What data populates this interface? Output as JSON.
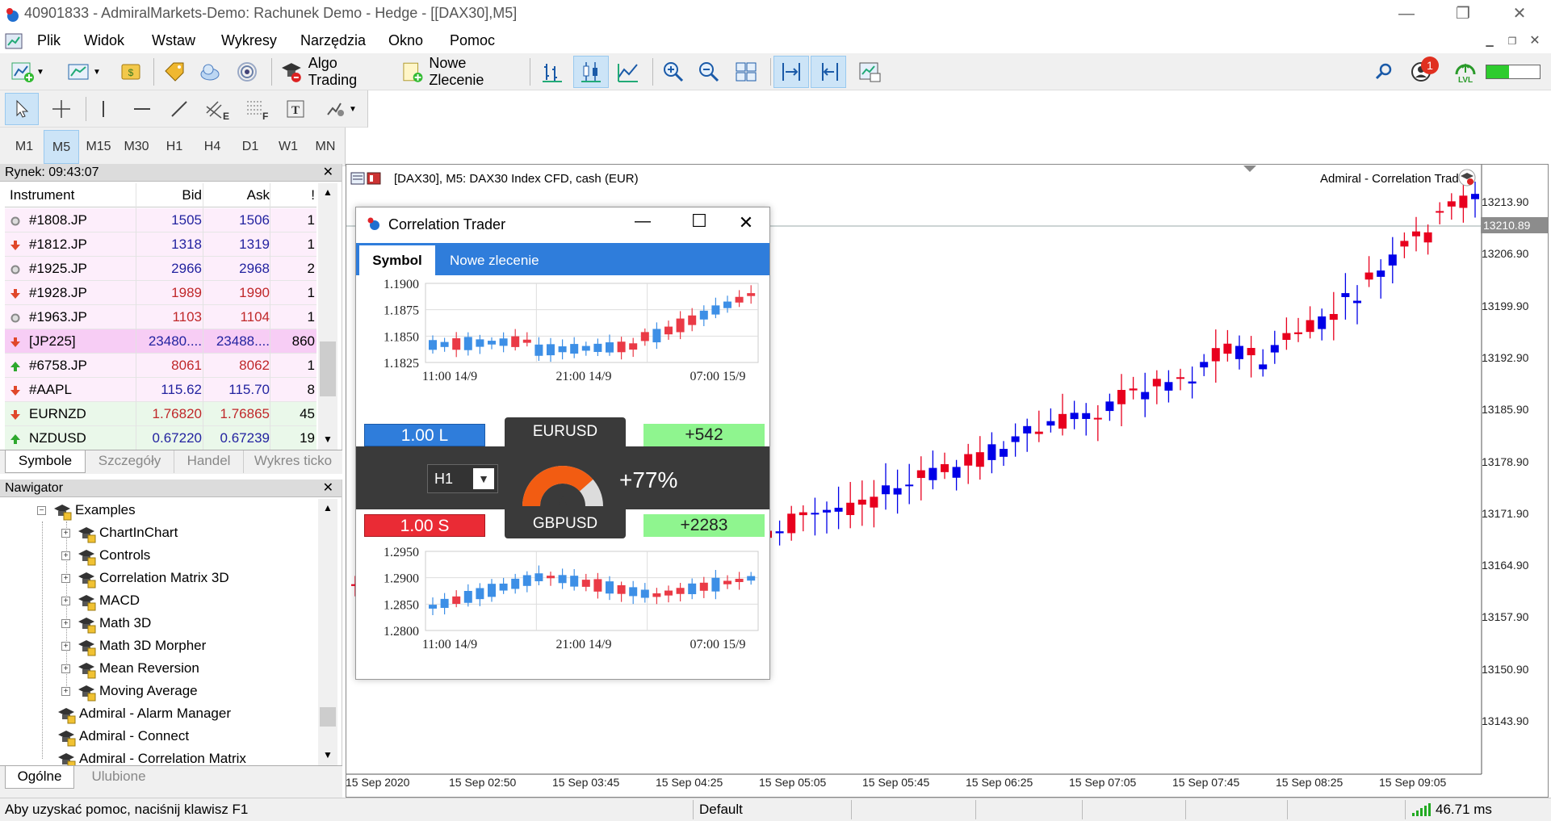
{
  "window": {
    "title": "40901833 - AdmiralMarkets-Demo: Rachunek Demo - Hedge - [[DAX30],M5]",
    "minimize": "—",
    "restore": "❐",
    "close": "✕"
  },
  "menu": [
    "Plik",
    "Widok",
    "Wstaw",
    "Wykresy",
    "Narzędzia",
    "Okno",
    "Pomoc"
  ],
  "toolbar": {
    "algo_trading": "Algo Trading",
    "new_order": "Nowe Zlecenie",
    "notification_count": "1",
    "lvl": "LVL"
  },
  "timeframes": [
    "M1",
    "M5",
    "M15",
    "M30",
    "H1",
    "H4",
    "D1",
    "W1",
    "MN"
  ],
  "active_timeframe": "M5",
  "market_watch": {
    "title": "Rynek: 09:43:07",
    "headers": {
      "instrument": "Instrument",
      "bid": "Bid",
      "ask": "Ask",
      "spread": "!"
    },
    "rows": [
      {
        "symbol": "#1808.JP",
        "bid": "1505",
        "ask": "1506",
        "spread": "1",
        "dir": "none",
        "color": "#2323a0",
        "bg": "#fdeefb"
      },
      {
        "symbol": "#1812.JP",
        "bid": "1318",
        "ask": "1319",
        "spread": "1",
        "dir": "down",
        "color": "#2323a0",
        "bg": "#fdeefb"
      },
      {
        "symbol": "#1925.JP",
        "bid": "2966",
        "ask": "2968",
        "spread": "2",
        "dir": "none",
        "color": "#2323a0",
        "bg": "#fdeefb"
      },
      {
        "symbol": "#1928.JP",
        "bid": "1989",
        "ask": "1990",
        "spread": "1",
        "dir": "down",
        "color": "#c0282a",
        "bg": "#fdeefb"
      },
      {
        "symbol": "#1963.JP",
        "bid": "1103",
        "ask": "1104",
        "spread": "1",
        "dir": "none",
        "color": "#c0282a",
        "bg": "#fdeefb"
      },
      {
        "symbol": "[JP225]",
        "bid": "23480....",
        "ask": "23488....",
        "spread": "860",
        "dir": "down",
        "color": "#2323a0",
        "bg": "#f7cdf5"
      },
      {
        "symbol": "#6758.JP",
        "bid": "8061",
        "ask": "8062",
        "spread": "1",
        "dir": "up",
        "color": "#c0282a",
        "bg": "#fdeefb"
      },
      {
        "symbol": "#AAPL",
        "bid": "115.62",
        "ask": "115.70",
        "spread": "8",
        "dir": "down",
        "color": "#2323a0",
        "bg": "#fdeefb"
      },
      {
        "symbol": "EURNZD",
        "bid": "1.76820",
        "ask": "1.76865",
        "spread": "45",
        "dir": "down",
        "color": "#c0282a",
        "bg": "#eaf8ea"
      },
      {
        "symbol": "NZDUSD",
        "bid": "0.67220",
        "ask": "0.67239",
        "spread": "19",
        "dir": "up",
        "color": "#2323a0",
        "bg": "#eaf8ea"
      }
    ],
    "tabs": [
      "Symbole",
      "Szczegóły",
      "Handel",
      "Wykres ticko"
    ]
  },
  "navigator": {
    "title": "Nawigator",
    "root": "Examples",
    "children": [
      "ChartInChart",
      "Controls",
      "Correlation Matrix 3D",
      "MACD",
      "Math 3D",
      "Math 3D Morpher",
      "Mean Reversion",
      "Moving Average"
    ],
    "siblings": [
      "Admiral - Alarm Manager",
      "Admiral - Connect",
      "Admiral - Correlation Matrix"
    ],
    "tabs": [
      "Ogólne",
      "Ulubione"
    ]
  },
  "chart": {
    "header": "[DAX30], M5:  DAX30 Index CFD, cash (EUR)",
    "ea_label": "Admiral - Correlation Trader",
    "current_price": "13210.89",
    "price_levels": [
      "13213.90",
      "13206.90",
      "13199.90",
      "13192.90",
      "13185.90",
      "13178.90",
      "13171.90",
      "13164.90",
      "13157.90",
      "13150.90",
      "13143.90"
    ],
    "time_labels": [
      "15 Sep 2020",
      "15 Sep 02:50",
      "15 Sep 03:45",
      "15 Sep 04:25",
      "15 Sep 05:05",
      "15 Sep 05:45",
      "15 Sep 06:25",
      "15 Sep 07:05",
      "15 Sep 07:45",
      "15 Sep 08:25",
      "15 Sep 09:05"
    ],
    "up_color": "#0000e8",
    "down_color": "#e8001e"
  },
  "correlation_trader": {
    "title": "Correlation Trader",
    "tabs": [
      "Symbol",
      "Nowe zlecenie"
    ],
    "top": {
      "symbol": "EURUSD",
      "lot": "1.00 L",
      "pnl": "+542",
      "y_labels": [
        "1.1900",
        "1.1875",
        "1.1850",
        "1.1825"
      ],
      "x_labels": [
        "11:00 14/9",
        "21:00 14/9",
        "07:00 15/9"
      ]
    },
    "timeframe": "H1",
    "correlation": "+77%",
    "bottom": {
      "symbol": "GBPUSD",
      "lot": "1.00 S",
      "pnl": "+2283",
      "y_labels": [
        "1.2950",
        "1.2900",
        "1.2850",
        "1.2800"
      ],
      "x_labels": [
        "11:00 14/9",
        "21:00 14/9",
        "07:00 15/9"
      ]
    }
  },
  "status": {
    "help": "Aby uzyskać pomoc, naciśnij klawisz F1",
    "profile": "Default",
    "ping": "46.71 ms"
  }
}
